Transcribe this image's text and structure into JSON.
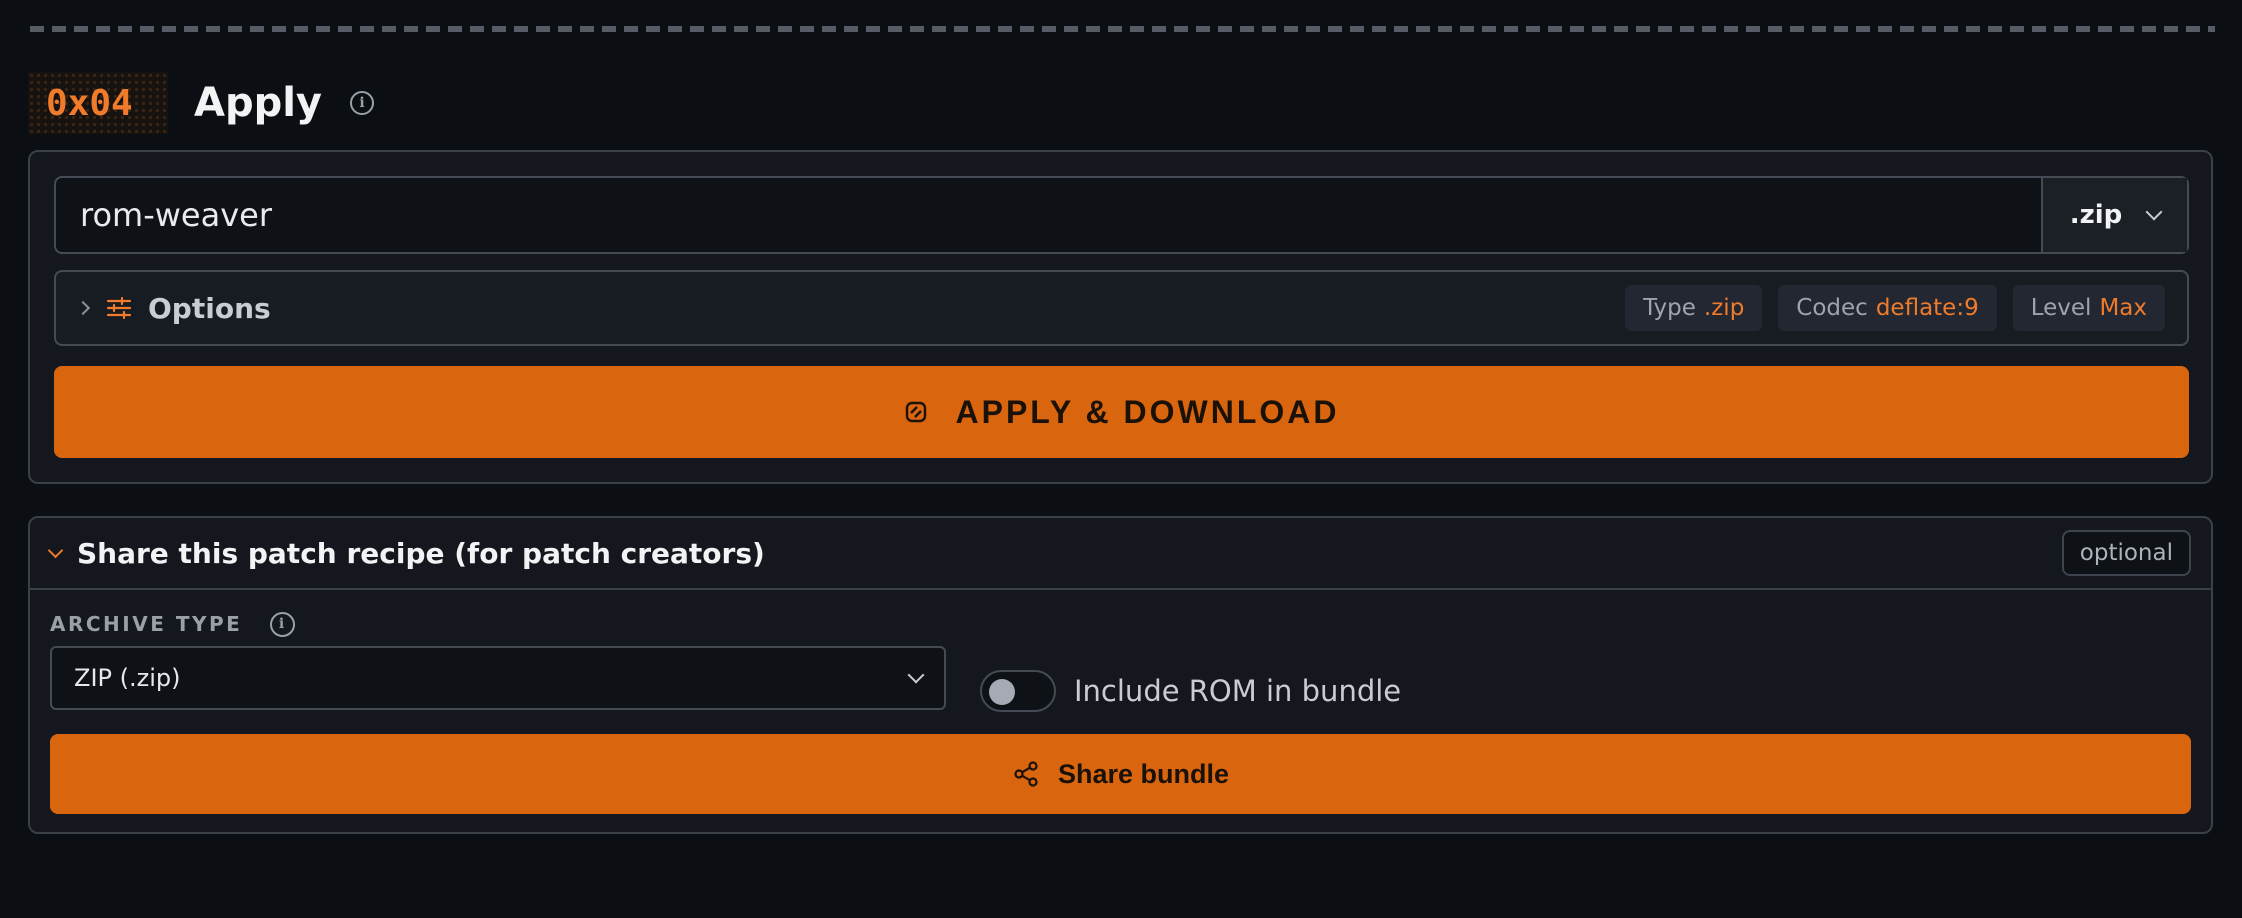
{
  "header": {
    "step_code": "0x04",
    "title": "Apply"
  },
  "apply": {
    "name_value": "rom-weaver",
    "extension": ".zip",
    "options_label": "Options",
    "chips": [
      {
        "key": "Type",
        "value": ".zip"
      },
      {
        "key": "Codec",
        "value": "deflate:9"
      },
      {
        "key": "Level",
        "value": "Max"
      }
    ],
    "button_label": "APPLY & DOWNLOAD"
  },
  "share": {
    "title": "Share this patch recipe (for patch creators)",
    "optional_badge": "optional",
    "archive_type_label": "ARCHIVE TYPE",
    "archive_type_value": "ZIP (.zip)",
    "include_rom_label": "Include ROM in bundle",
    "include_rom_on": false,
    "button_label": "Share bundle"
  },
  "colors": {
    "accent": "#d9650f",
    "accent_text": "#f07b2a",
    "background": "#0b0e13",
    "panel": "#14171d"
  }
}
